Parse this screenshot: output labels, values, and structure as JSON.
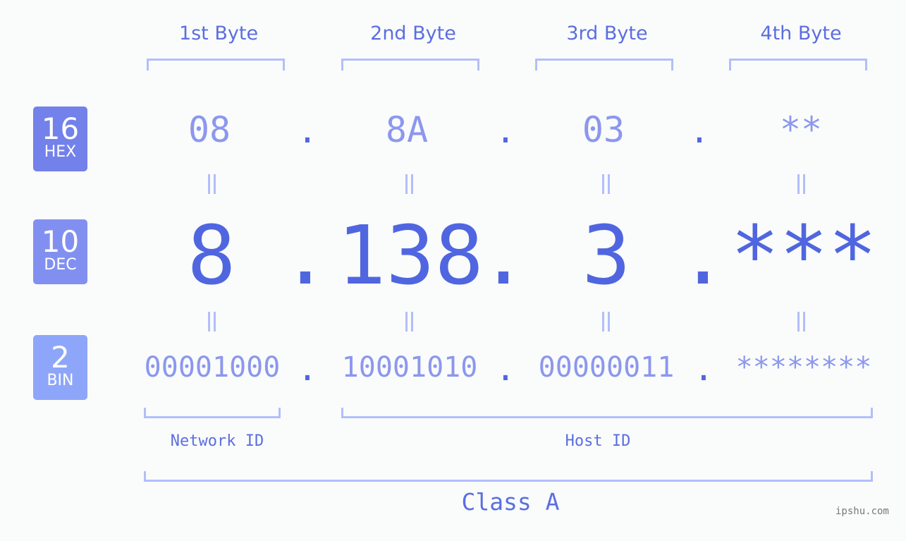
{
  "badges": [
    {
      "number": "16",
      "label": "HEX",
      "color": "#7381ea"
    },
    {
      "number": "10",
      "label": "DEC",
      "color": "#8190f0"
    },
    {
      "number": "2",
      "label": "BIN",
      "color": "#8ea6f9"
    }
  ],
  "byte_headers": [
    "1st Byte",
    "2nd Byte",
    "3rd Byte",
    "4th Byte"
  ],
  "hex": [
    "08",
    "8A",
    "03",
    "**"
  ],
  "dec": [
    "8",
    "138",
    "3",
    "***"
  ],
  "bin": [
    "00001000",
    "10001010",
    "00000011",
    "********"
  ],
  "separator": ".",
  "equals": "=",
  "network_label": "Network ID",
  "host_label": "Host ID",
  "class_label": "Class A",
  "watermark": "ipshu.com"
}
